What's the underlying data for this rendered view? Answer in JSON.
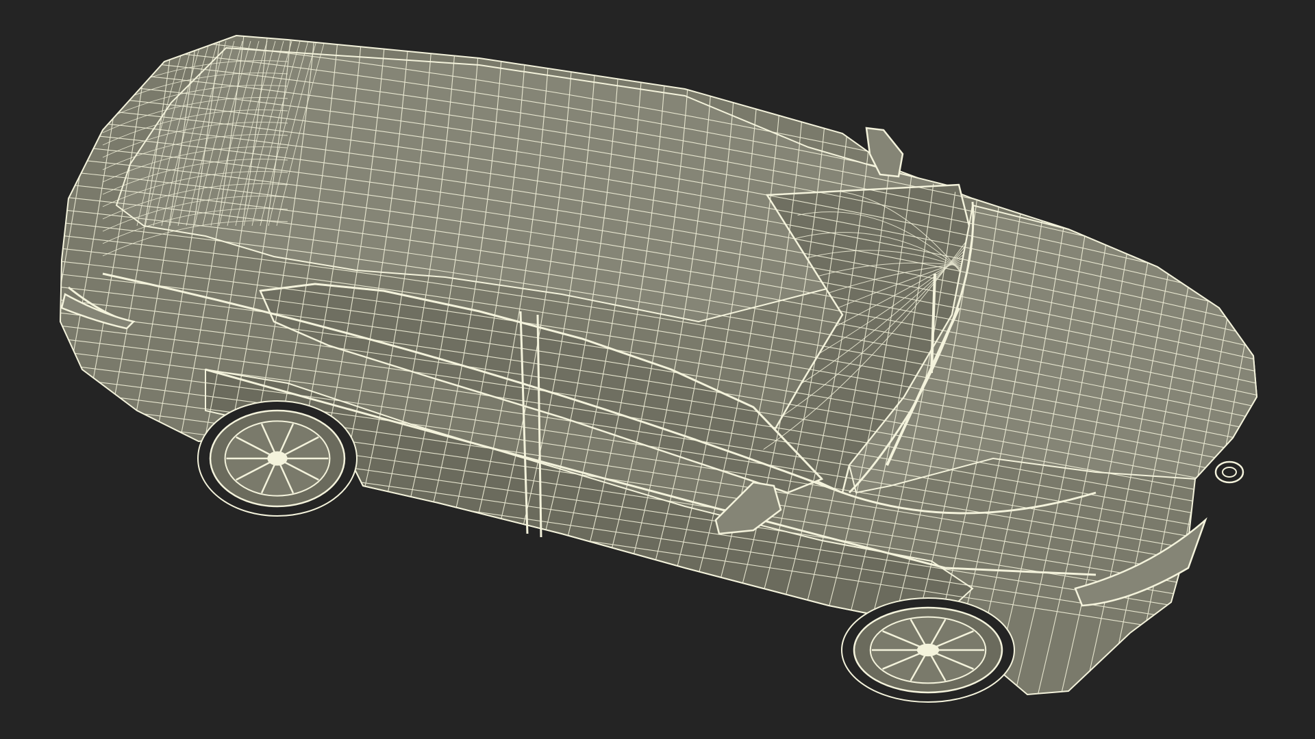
{
  "scene": {
    "subject": "car-wireframe-render",
    "colors": {
      "background": "#242424",
      "surface": "#7a7a6b",
      "surface_light": "#858576",
      "surface_dark": "#6b6b5d",
      "wire": "#f4f3dc",
      "glass": "#6f6f61"
    },
    "view": "top-three-quarter",
    "shading": "flat-gray-with-wireframe-overlay"
  }
}
